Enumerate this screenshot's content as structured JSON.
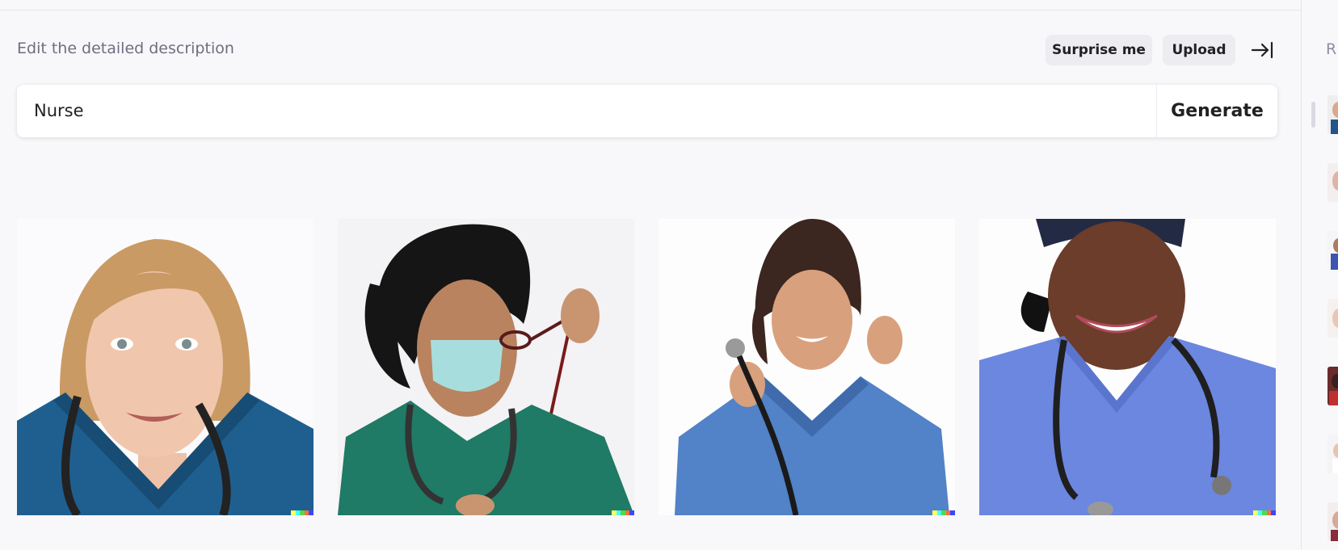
{
  "editor": {
    "hint": "Edit the detailed description",
    "surprise_label": "Surprise me",
    "upload_label": "Upload",
    "prompt_value": "Nurse",
    "generate_label": "Generate"
  },
  "results": [
    {
      "alt": "Nurse in dark blue scrubs with stethoscope"
    },
    {
      "alt": "Nurse in green scrubs wearing a face mask holding glasses"
    },
    {
      "alt": "Nurse in light blue scrubs holding a stethoscope"
    },
    {
      "alt": "Smiling nurse in blue scrubs with stethoscope and cap"
    }
  ],
  "history": {
    "title_initial": "R",
    "thumbnail_count": 8
  },
  "colors": {
    "background": "#f8f8fa",
    "button": "#ececf1",
    "text": "#202123",
    "muted": "#6e6e80",
    "signature": [
      "#ffff66",
      "#42ffff",
      "#51da4c",
      "#ff6e3c",
      "#3c46ff"
    ]
  }
}
